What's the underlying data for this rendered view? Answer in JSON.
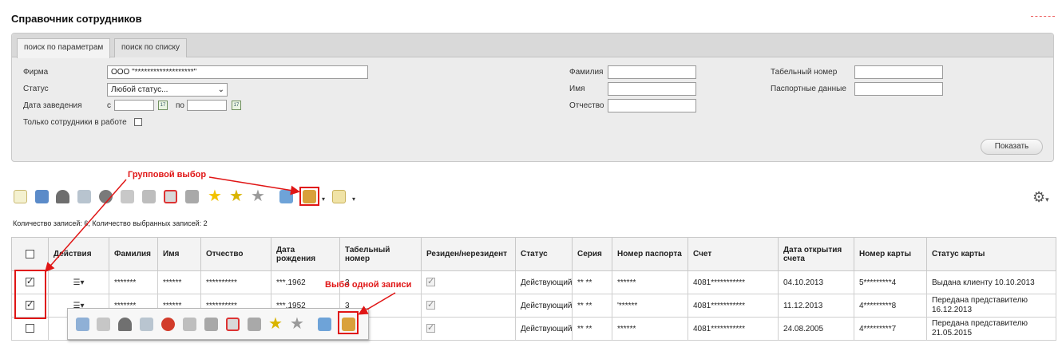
{
  "page_title": "Справочник сотрудников",
  "tabs": [
    {
      "label": "поиск по параметрам"
    },
    {
      "label": "поиск по списку"
    }
  ],
  "filters": {
    "firm_label": "Фирма",
    "firm_value": "ООО \"*******************\"",
    "status_label": "Статус",
    "status_value": "Любой статус...",
    "date_label": "Дата заведения",
    "from_label": "с",
    "to_label": "по",
    "only_working_label": "Только сотрудники в работе",
    "surname_label": "Фамилия",
    "name_label": "Имя",
    "patronymic_label": "Отчество",
    "tab_number_label": "Табельный номер",
    "passport_label": "Паспортные данные",
    "show_button": "Показать"
  },
  "toolbar_icons": [
    "new-document-icon",
    "download-icon",
    "award-icon",
    "printer-icon",
    "people-icon",
    "card-icon",
    "card-alt-icon",
    "card-delete-icon",
    "card-stack-icon",
    "star-icon",
    "star-add-icon",
    "star-gray-icon",
    "calendar-card-icon",
    "group-select-icon",
    "document-menu-icon"
  ],
  "records_summary": "Количество записей: 6, Количество выбранных записей: 2",
  "table": {
    "headers": [
      "",
      "Действия",
      "Фамилия",
      "Имя",
      "Отчество",
      "Дата рождения",
      "Табельный номер",
      "Резиден/нерезидент",
      "Статус",
      "Серия",
      "Номер паспорта",
      "Счет",
      "Дата открытия счета",
      "Номер карты",
      "Статус карты"
    ],
    "rows": [
      {
        "checked": true,
        "surname": "*******",
        "name": "******",
        "patronymic": "**********",
        "birth": "***.1962",
        "tab": "3",
        "resident": true,
        "status": "Действующий",
        "series": "** **",
        "passport": "******",
        "account": "4081***********",
        "opened": "04.10.2013",
        "card": "5*********4",
        "card_status": "Выдана клиенту 10.10.2013"
      },
      {
        "checked": true,
        "surname": "*******",
        "name": "******",
        "patronymic": "**********",
        "birth": "***.1952",
        "tab": "3",
        "resident": true,
        "status": "Действующий",
        "series": "** **",
        "passport": "'******",
        "account": "4081***********",
        "opened": "11.12.2013",
        "card": "4*********8",
        "card_status": "Передана представителю 16.12.2013"
      },
      {
        "checked": false,
        "surname": "",
        "name": "",
        "patronymic": "",
        "birth": "",
        "tab": "",
        "resident": true,
        "status": "Действующий",
        "series": "** **",
        "passport": "******",
        "account": "4081***********",
        "opened": "24.08.2005",
        "card": "4*********7",
        "card_status": "Передана представителю 21.05.2015"
      }
    ]
  },
  "annotations": {
    "group_select": "Групповой выбор",
    "single_select": "Выбо одной записи"
  },
  "row_menu_icons": [
    "view-icon",
    "card-icon",
    "award-icon",
    "printer-check-icon",
    "approve-icon",
    "card-alt-icon",
    "card-scan-icon",
    "card-delete-icon",
    "card-stack-icon",
    "star-add-icon",
    "star-gray-icon",
    "calendar-card-icon",
    "group-select-icon"
  ],
  "colors": {
    "annotation": "#e01515",
    "panel": "#ececec"
  }
}
